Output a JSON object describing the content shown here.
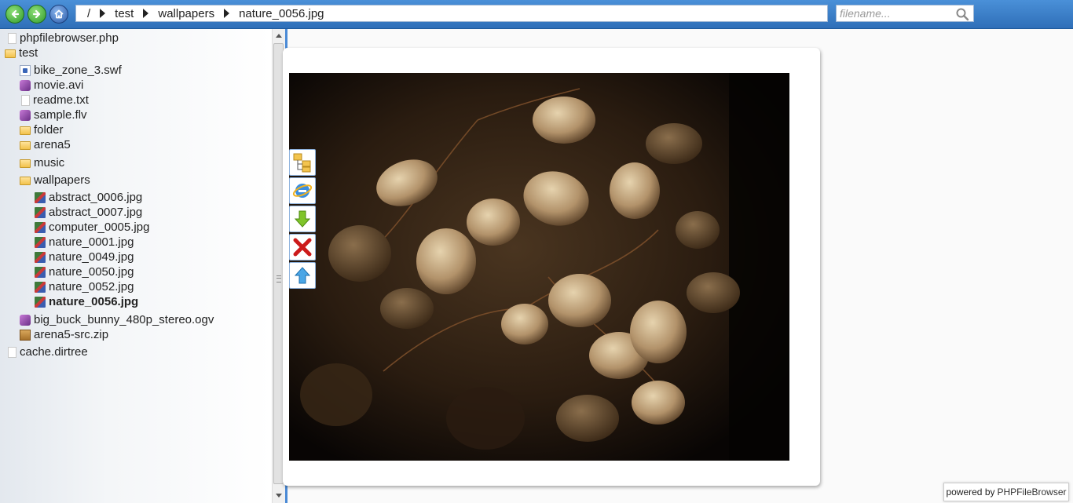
{
  "breadcrumb": {
    "root": "/",
    "items": [
      "test",
      "wallpapers",
      "nature_0056.jpg"
    ]
  },
  "search": {
    "placeholder": "filename..."
  },
  "tree": [
    {
      "label": "phpfilebrowser.php",
      "icon": "file-icon",
      "depth": 0
    },
    {
      "label": "test",
      "icon": "folder-icon",
      "depth": 0
    },
    {
      "label": "bike_zone_3.swf",
      "icon": "swf-file-icon",
      "depth": 1
    },
    {
      "label": "movie.avi",
      "icon": "video-file-icon",
      "depth": 1
    },
    {
      "label": "readme.txt",
      "icon": "file-icon",
      "depth": 1
    },
    {
      "label": "sample.flv",
      "icon": "video-file-icon",
      "depth": 1
    },
    {
      "label": "folder",
      "icon": "folder-icon",
      "depth": 1
    },
    {
      "label": "arena5",
      "icon": "folder-icon",
      "depth": 1
    },
    {
      "label": "music",
      "icon": "folder-icon",
      "depth": 1
    },
    {
      "label": "wallpapers",
      "icon": "folder-icon",
      "depth": 1
    },
    {
      "label": "abstract_0006.jpg",
      "icon": "image-file-icon",
      "depth": 2
    },
    {
      "label": "abstract_0007.jpg",
      "icon": "image-file-icon",
      "depth": 2
    },
    {
      "label": "computer_0005.jpg",
      "icon": "image-file-icon",
      "depth": 2
    },
    {
      "label": "nature_0001.jpg",
      "icon": "image-file-icon",
      "depth": 2
    },
    {
      "label": "nature_0049.jpg",
      "icon": "image-file-icon",
      "depth": 2
    },
    {
      "label": "nature_0050.jpg",
      "icon": "image-file-icon",
      "depth": 2
    },
    {
      "label": "nature_0052.jpg",
      "icon": "image-file-icon",
      "depth": 2
    },
    {
      "label": "nature_0056.jpg",
      "icon": "image-file-icon",
      "depth": 2,
      "selected": true
    },
    {
      "label": "big_buck_bunny_480p_stereo.ogv",
      "icon": "video-file-icon",
      "depth": 1
    },
    {
      "label": "arena5-src.zip",
      "icon": "zip-file-icon",
      "depth": 1
    },
    {
      "label": "cache.dirtree",
      "icon": "file-icon",
      "depth": 0
    }
  ],
  "tools": [
    "tree-view-icon",
    "open-in-browser-icon",
    "download-icon",
    "delete-icon",
    "upload-icon"
  ],
  "footer": {
    "powered_by": "powered by",
    "brand": "PHPFileBrowser"
  },
  "colors": {
    "accent": "#2f6fb8",
    "splitter": "#4a8ad6"
  }
}
